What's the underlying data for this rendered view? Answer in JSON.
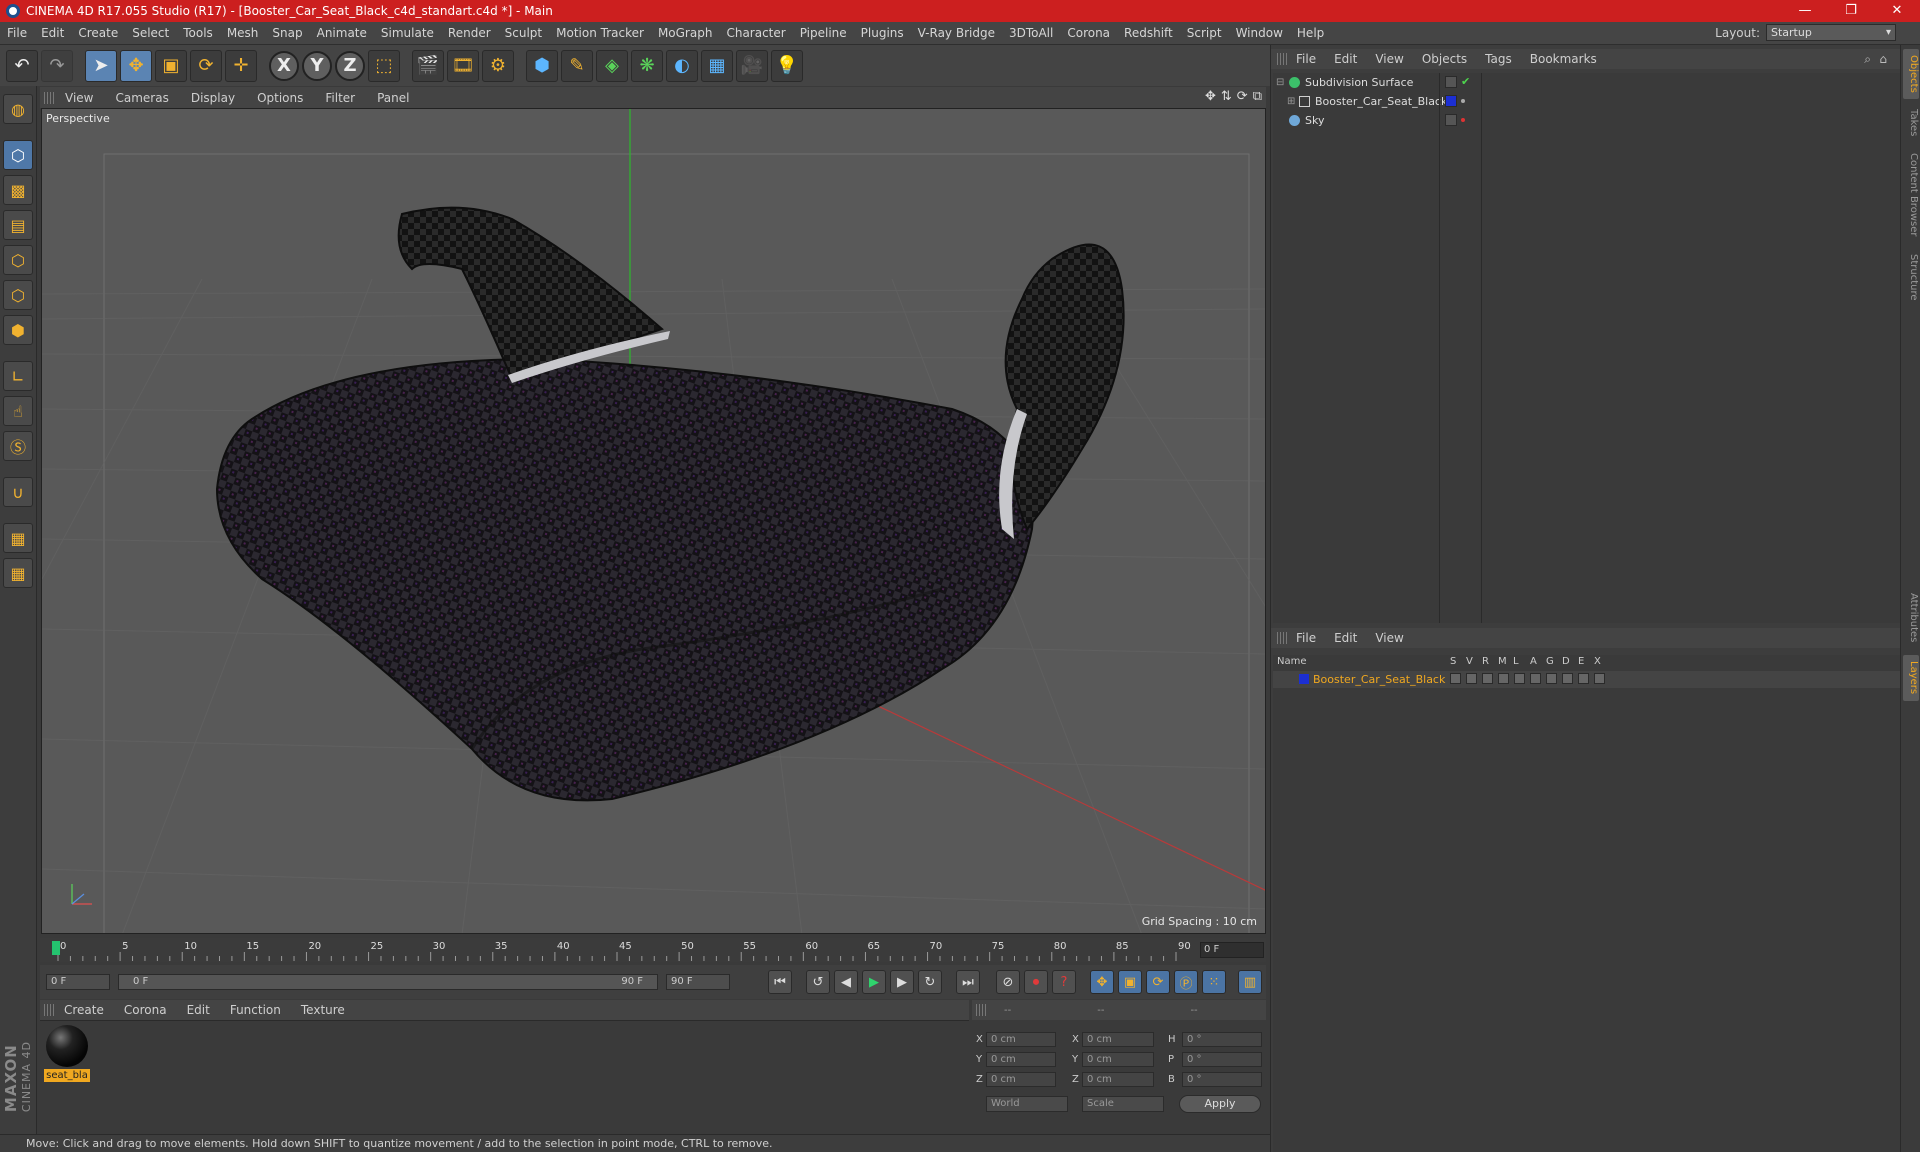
{
  "titlebar": {
    "title": "CINEMA 4D R17.055 Studio (R17) - [Booster_Car_Seat_Black_c4d_standart.c4d *] - Main",
    "minimize": "—",
    "restore": "❐",
    "close": "✕"
  },
  "menu": [
    "File",
    "Edit",
    "Create",
    "Select",
    "Tools",
    "Mesh",
    "Snap",
    "Animate",
    "Simulate",
    "Render",
    "Sculpt",
    "Motion Tracker",
    "MoGraph",
    "Character",
    "Pipeline",
    "Plugins",
    "V-Ray Bridge",
    "3DToAll",
    "Corona",
    "Redshift",
    "Script",
    "Window",
    "Help"
  ],
  "layout": {
    "label": "Layout:",
    "value": "Startup"
  },
  "toolbar_icons": [
    "undo-icon",
    "redo-icon",
    "select-arrow-icon",
    "move-icon",
    "scale-icon",
    "rotate-icon",
    "live-move-icon",
    "x-axis-icon",
    "y-axis-icon",
    "z-axis-icon",
    "coordinate-system-icon",
    "render-view-icon",
    "render-picture-viewer-icon",
    "render-settings-icon",
    "cube-icon",
    "pen-spline-icon",
    "subdivision-icon",
    "array-icon",
    "deformer-icon",
    "floor-icon",
    "camera-icon",
    "light-icon"
  ],
  "axis_labels": {
    "x": "X",
    "y": "Y",
    "z": "Z"
  },
  "viewport": {
    "menu": [
      "View",
      "Cameras",
      "Display",
      "Options",
      "Filter",
      "Panel"
    ],
    "label": "Perspective",
    "grid_spacing": "Grid Spacing : 10 cm"
  },
  "timeline": {
    "ticks": [
      "0",
      "5",
      "10",
      "15",
      "20",
      "25",
      "30",
      "35",
      "40",
      "45",
      "50",
      "55",
      "60",
      "65",
      "70",
      "75",
      "80",
      "85",
      "90"
    ],
    "current_frame": "0 F"
  },
  "transport": {
    "start_field": "0 F",
    "range_start": "0 F",
    "range_end": "90 F",
    "end_field": "90 F"
  },
  "material_panel": {
    "menu": [
      "Create",
      "Corona",
      "Edit",
      "Function",
      "Texture"
    ],
    "materials": [
      {
        "name": "seat_bla"
      }
    ]
  },
  "coordinates": {
    "headers": [
      "--",
      "--",
      "--"
    ],
    "rows": [
      {
        "a": "X",
        "a_val": "0 cm",
        "b": "X",
        "b_val": "0 cm",
        "c": "H",
        "c_val": "0 °"
      },
      {
        "a": "Y",
        "a_val": "0 cm",
        "b": "Y",
        "b_val": "0 cm",
        "c": "P",
        "c_val": "0 °"
      },
      {
        "a": "Z",
        "a_val": "0 cm",
        "b": "Z",
        "b_val": "0 cm",
        "c": "B",
        "c_val": "0 °"
      }
    ],
    "mode": "World",
    "transform": "Scale",
    "apply": "Apply"
  },
  "statusbar": "Move: Click and drag to move elements. Hold down SHIFT to quantize movement / add to the selection in point mode, CTRL to remove.",
  "object_manager": {
    "menu": [
      "File",
      "Edit",
      "View",
      "Objects",
      "Tags",
      "Bookmarks"
    ],
    "objects": [
      {
        "name": "Subdivision Surface",
        "color": "#3cc06a"
      },
      {
        "name": "Booster_Car_Seat_Black",
        "color": "#cfcfcf"
      },
      {
        "name": "Sky",
        "color": "#6fa8d8"
      }
    ]
  },
  "layer_manager": {
    "menu": [
      "File",
      "Edit",
      "View"
    ],
    "columns": {
      "name": "Name",
      "flags": [
        "S",
        "V",
        "R",
        "M",
        "L",
        "A",
        "G",
        "D",
        "E",
        "X"
      ]
    },
    "layers": [
      {
        "name": "Booster_Car_Seat_Black",
        "color": "#1c2fd3"
      }
    ]
  },
  "side_tabs": [
    "Objects",
    "Takes",
    "Content Browser",
    "Structure",
    "Attributes",
    "Layers"
  ],
  "brand": {
    "line1": "MAXON",
    "line2": "CINEMA 4D"
  },
  "colors": {
    "titlebar": "#cc1f1f",
    "accent": "#f0a820",
    "panel": "#3a3a3a"
  }
}
